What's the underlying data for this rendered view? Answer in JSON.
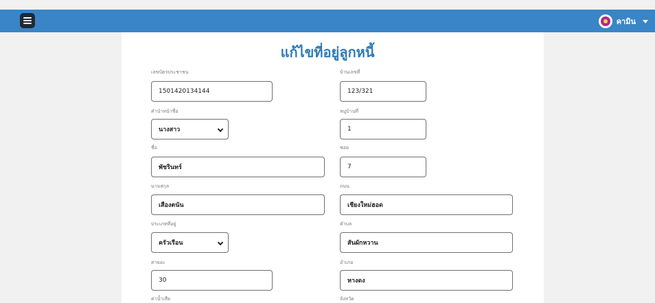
{
  "header": {
    "menu_icon": "hamburger-icon",
    "username": "คามิน"
  },
  "page": {
    "title": "แก้ไขที่อยู่ลูกหนี้"
  },
  "left": {
    "id_label": "เลขบัตรประชาชน",
    "id_value": "1501420134144",
    "prefix_label": "คำนำหน้าชื่อ",
    "prefix_value": "นางสาว",
    "firstname_label": "ชื่อ",
    "firstname_value": "พัชรินทร์",
    "lastname_label": "นามสกุล",
    "lastname_value": "เสืองตนัน",
    "residence_label": "ประเภทที่อยู่",
    "residence_value": "ครัวเรือน",
    "fee_label": "ค่ายอะ",
    "fee_value": "30",
    "water_label": "ค่าน้ำเสีย"
  },
  "right": {
    "house_label": "บ้านเลขที่",
    "house_value": "123/321",
    "village_label": "หมู่บ้านที่",
    "village_value": "1",
    "soi_label": "ซอย",
    "soi_value": "7",
    "road_label": "ถนน",
    "road_value": "เชียงใหม่ฮอด",
    "tambon_label": "ตำบล",
    "tambon_value": "สันผักหวาน",
    "amphoe_label": "อำเภอ",
    "amphoe_value": "หางดง",
    "province_label": "จังหวัด"
  }
}
